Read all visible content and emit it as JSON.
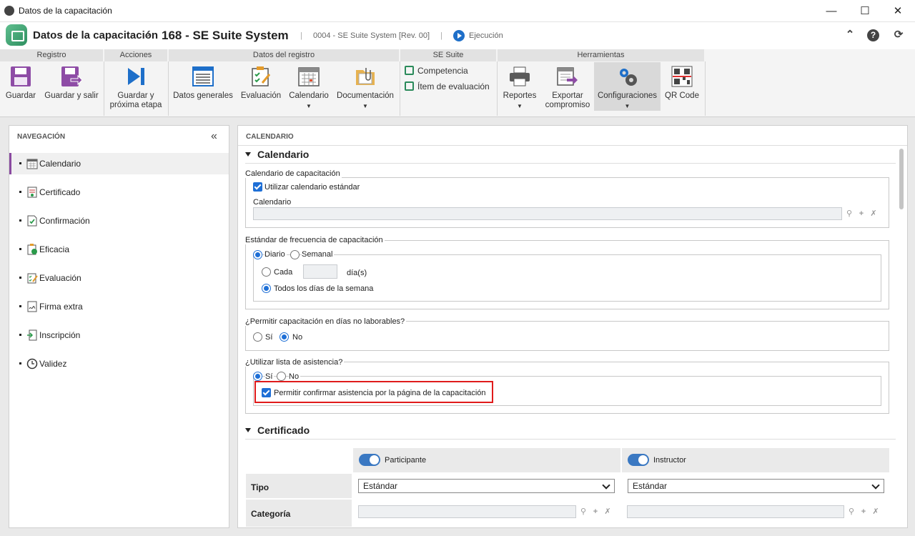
{
  "window": {
    "title": "Datos de la capacitación"
  },
  "header": {
    "module": "Datos de la capacitación",
    "record": "168 - SE Suite System",
    "revision": "0004 - SE Suite System [Rev. 00]",
    "status": "Ejecución"
  },
  "ribbon": {
    "groups": [
      "Registro",
      "Acciones",
      "Datos del registro",
      "SE Suite",
      "Herramientas"
    ],
    "buttons": {
      "guardar": "Guardar",
      "guardar_salir": "Guardar y salir",
      "guardar_proxima_1": "Guardar y",
      "guardar_proxima_2": "próxima etapa",
      "datos_generales": "Datos generales",
      "evaluacion": "Evaluación",
      "calendario": "Calendario",
      "documentacion": "Documentación",
      "competencia": "Competencia",
      "item_evaluacion": "Ítem de evaluación",
      "reportes": "Reportes",
      "exportar_1": "Exportar",
      "exportar_2": "compromiso",
      "configuraciones": "Configuraciones",
      "qr": "QR Code"
    }
  },
  "nav": {
    "title": "NAVEGACIÓN",
    "items": [
      "Calendario",
      "Certificado",
      "Confirmación",
      "Eficacia",
      "Evaluación",
      "Firma extra",
      "Inscripción",
      "Validez"
    ]
  },
  "content": {
    "header": "CALENDARIO",
    "calendario_section": "Calendario",
    "cal_cap_legend": "Calendario de capacitación",
    "usar_estandar": "Utilizar calendario estándar",
    "calendario_label": "Calendario",
    "calendario_value": "",
    "frecuencia_legend": "Estándar de frecuencia de capacitación",
    "diario": "Diario",
    "semanal": "Semanal",
    "cada": "Cada",
    "cada_value": "",
    "dias": "día(s)",
    "todos_dias": "Todos los días de la semana",
    "no_laborables_legend": "¿Permitir capacitación en días no laborables?",
    "si": "Sí",
    "no": "No",
    "asistencia_legend": "¿Utilizar lista de asistencia?",
    "permitir_confirmar": "Permitir confirmar asistencia por la página de la capacitación",
    "certificado_section": "Certificado",
    "participante": "Participante",
    "instructor": "Instructor",
    "tipo": "Tipo",
    "tipo_participante": "Estándar",
    "tipo_instructor": "Estándar",
    "categoria": "Categoría"
  },
  "colors": {
    "accent": "#1e6fd6",
    "highlight": "#e01b1b",
    "nav_marker": "#8a4aa0"
  }
}
